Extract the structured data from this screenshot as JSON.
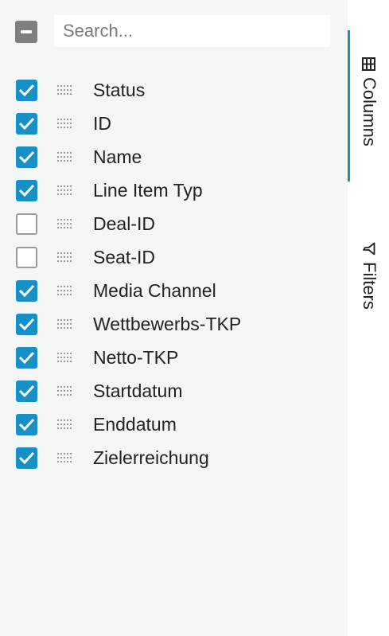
{
  "search": {
    "placeholder": "Search..."
  },
  "columns": [
    {
      "label": "Status",
      "checked": true
    },
    {
      "label": "ID",
      "checked": true
    },
    {
      "label": "Name",
      "checked": true
    },
    {
      "label": "Line Item Typ",
      "checked": true
    },
    {
      "label": "Deal-ID",
      "checked": false
    },
    {
      "label": "Seat-ID",
      "checked": false
    },
    {
      "label": "Media Channel",
      "checked": true
    },
    {
      "label": "Wettbewerbs-TKP",
      "checked": true
    },
    {
      "label": "Netto-TKP",
      "checked": true
    },
    {
      "label": "Startdatum",
      "checked": true
    },
    {
      "label": "Enddatum",
      "checked": true
    },
    {
      "label": "Zielerreichung",
      "checked": true
    }
  ],
  "side_tabs": {
    "columns": {
      "label": "Columns",
      "icon": "columns-icon",
      "active": true
    },
    "filters": {
      "label": "Filters",
      "icon": "filter-icon",
      "active": false
    }
  },
  "colors": {
    "accent": "#1790c8",
    "panel_bg": "#f5f5f5"
  }
}
